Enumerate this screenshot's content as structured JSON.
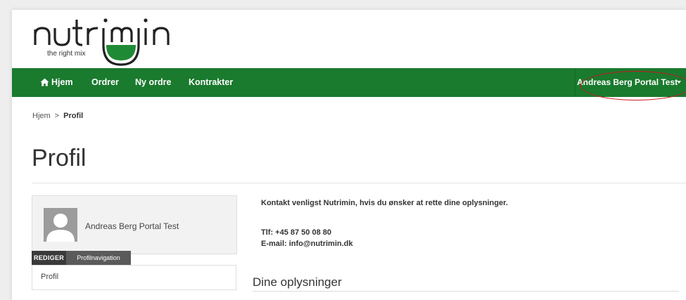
{
  "brand": {
    "name": "nutrimin",
    "tagline": "the right mix",
    "colors": {
      "primary": "#1a7a2e",
      "highlight": "#c8181e"
    }
  },
  "navbar": {
    "items": [
      {
        "label": "Hjem",
        "icon": "home-icon"
      },
      {
        "label": "Ordrer"
      },
      {
        "label": "Ny ordre"
      },
      {
        "label": "Kontrakter"
      }
    ],
    "user_menu": {
      "label": "Andreas Berg Portal Test",
      "icon": "caret-down-icon"
    }
  },
  "breadcrumb": {
    "home": "Hjem",
    "separator": ">",
    "current": "Profil"
  },
  "page": {
    "title": "Profil"
  },
  "profile": {
    "name": "Andreas Berg Portal Test",
    "tabs": {
      "edit": "REDIGER",
      "navigation": "Profilnavigation"
    },
    "nav_items": [
      "Profil"
    ]
  },
  "contact": {
    "message": "Kontakt venligst Nutrimin, hvis du ønsker at rette dine oplysninger.",
    "phone": "Tlf: +45 87 50 08 80",
    "email": "E-mail: info@nutrimin.dk"
  },
  "section": {
    "title": "Dine oplysninger"
  }
}
